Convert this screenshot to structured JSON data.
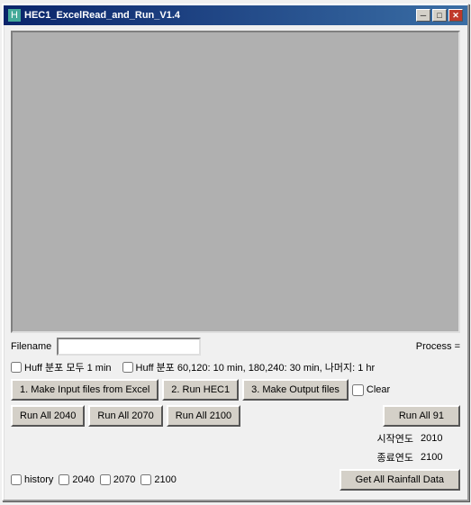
{
  "window": {
    "title": "HEC1_ExcelRead_and_Run_V1.4",
    "icon": "H"
  },
  "title_buttons": {
    "minimize": "─",
    "maximize": "□",
    "close": "✕"
  },
  "filename_section": {
    "label": "Filename",
    "value": "",
    "process_label": "Process ="
  },
  "checkboxes": {
    "huff1": {
      "label": "Huff 분포 모두 1 min",
      "checked": false
    },
    "huff2": {
      "label": "Huff 분포 60,120: 10 min, 180,240: 30 min, 나머지: 1 hr",
      "checked": false
    }
  },
  "buttons": {
    "make_input": "1. Make Input files from Excel",
    "run_hec1": "2. Run HEC1",
    "make_output": "3. Make Output files",
    "clear_label": "Clear",
    "run_all_2040": "Run All 2040",
    "run_all_2070": "Run All 2070",
    "run_all_2100": "Run All 2100",
    "run_all_91": "Run All 91",
    "get_rainfall": "Get All Rainfall Data"
  },
  "year_fields": {
    "start_label": "시작연도",
    "start_value": "2010",
    "end_label": "종료연도",
    "end_value": "2100"
  },
  "bottom_checkboxes": {
    "history": "history",
    "y2040": "2040",
    "y2070": "2070",
    "y2100": "2100"
  }
}
